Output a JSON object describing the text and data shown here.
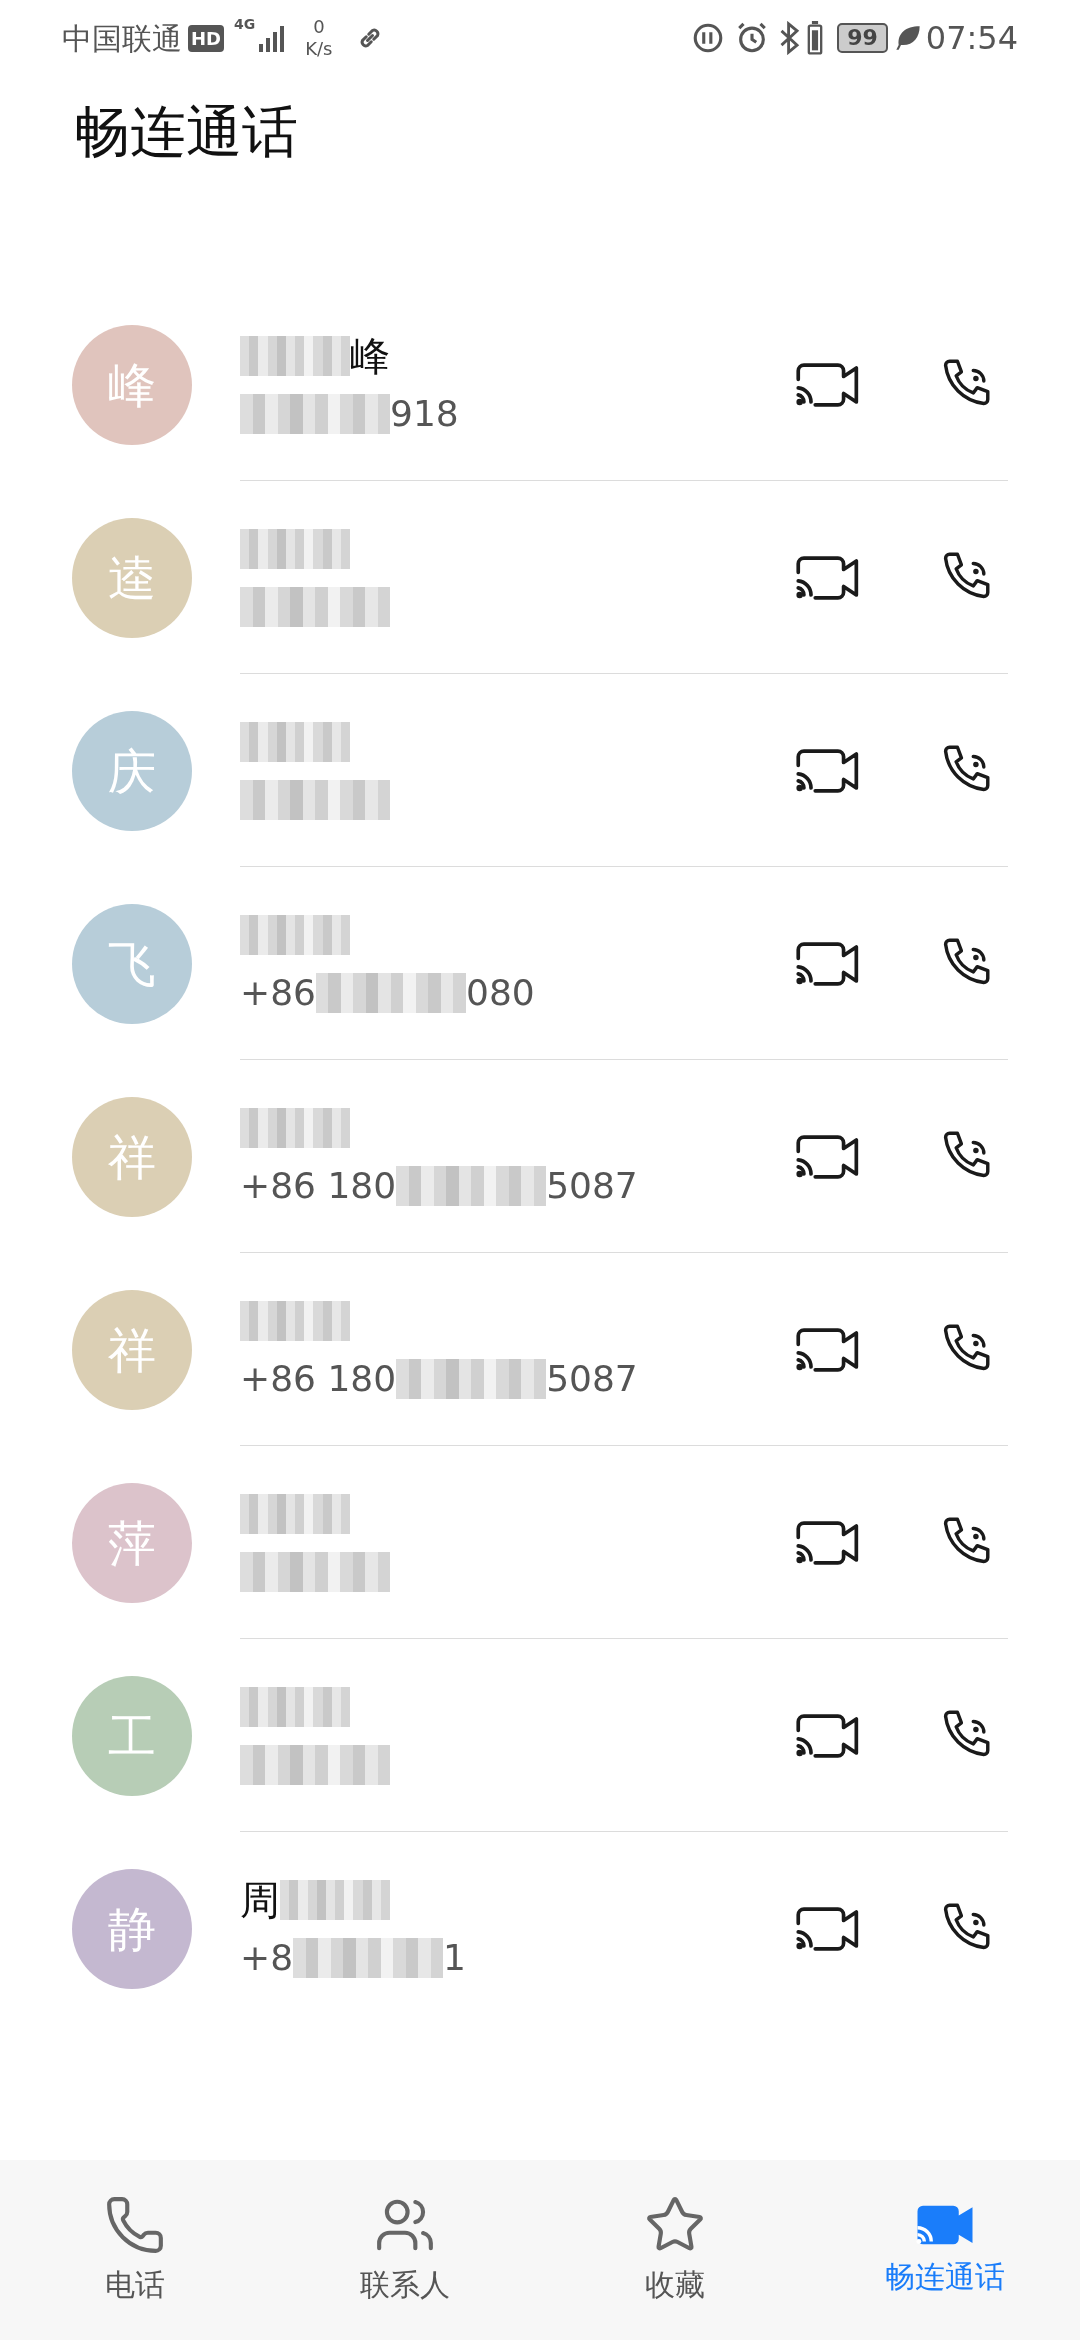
{
  "status_bar": {
    "carrier": "中国联通",
    "hd_badge": "HD",
    "network": "4G",
    "speed_value": "0",
    "speed_unit": "K/s",
    "battery": "99",
    "time": "07:54"
  },
  "title": "畅连通话",
  "contacts": [
    {
      "avatar": "峰",
      "color": "#e0c4bd",
      "name": [
        {
          "kind": "blur"
        },
        {
          "kind": "text",
          "text": "峰"
        }
      ],
      "phone": [
        {
          "kind": "blur"
        },
        {
          "kind": "text",
          "text": "918"
        }
      ]
    },
    {
      "avatar": "逵",
      "color": "#dbcfb4",
      "name": [
        {
          "kind": "blur"
        }
      ],
      "phone": [
        {
          "kind": "blur"
        }
      ]
    },
    {
      "avatar": "庆",
      "color": "#b7cdd9",
      "name": [
        {
          "kind": "blur"
        }
      ],
      "phone": [
        {
          "kind": "blur"
        }
      ]
    },
    {
      "avatar": "飞",
      "color": "#b7cdd9",
      "name": [
        {
          "kind": "blur"
        }
      ],
      "phone": [
        {
          "kind": "text",
          "text": "+86"
        },
        {
          "kind": "blur"
        },
        {
          "kind": "text",
          "text": "080"
        }
      ]
    },
    {
      "avatar": "祥",
      "color": "#dbcfb4",
      "name": [
        {
          "kind": "blur"
        }
      ],
      "phone": [
        {
          "kind": "text",
          "text": "+86 180"
        },
        {
          "kind": "blur"
        },
        {
          "kind": "text",
          "text": "5087"
        }
      ]
    },
    {
      "avatar": "祥",
      "color": "#dbcfb4",
      "name": [
        {
          "kind": "blur"
        }
      ],
      "phone": [
        {
          "kind": "text",
          "text": "+86 180"
        },
        {
          "kind": "blur"
        },
        {
          "kind": "text",
          "text": "5087"
        }
      ]
    },
    {
      "avatar": "萍",
      "color": "#dcc3cb",
      "name": [
        {
          "kind": "blur"
        }
      ],
      "phone": [
        {
          "kind": "blur"
        }
      ]
    },
    {
      "avatar": "工",
      "color": "#b7cdb6",
      "name": [
        {
          "kind": "blur"
        }
      ],
      "phone": [
        {
          "kind": "blur"
        }
      ]
    },
    {
      "avatar": "静",
      "color": "#c4b8d0",
      "name": [
        {
          "kind": "text",
          "text": "周"
        },
        {
          "kind": "blur"
        }
      ],
      "phone": [
        {
          "kind": "text",
          "text": "+8"
        },
        {
          "kind": "blur"
        },
        {
          "kind": "text",
          "text": "1"
        }
      ]
    }
  ],
  "tabs": [
    {
      "kind": "phone",
      "label": "电话",
      "selected": false
    },
    {
      "kind": "contacts",
      "label": "联系人",
      "selected": false
    },
    {
      "kind": "favorites",
      "label": "收藏",
      "selected": false
    },
    {
      "kind": "video",
      "label": "畅连通话",
      "selected": true
    }
  ]
}
